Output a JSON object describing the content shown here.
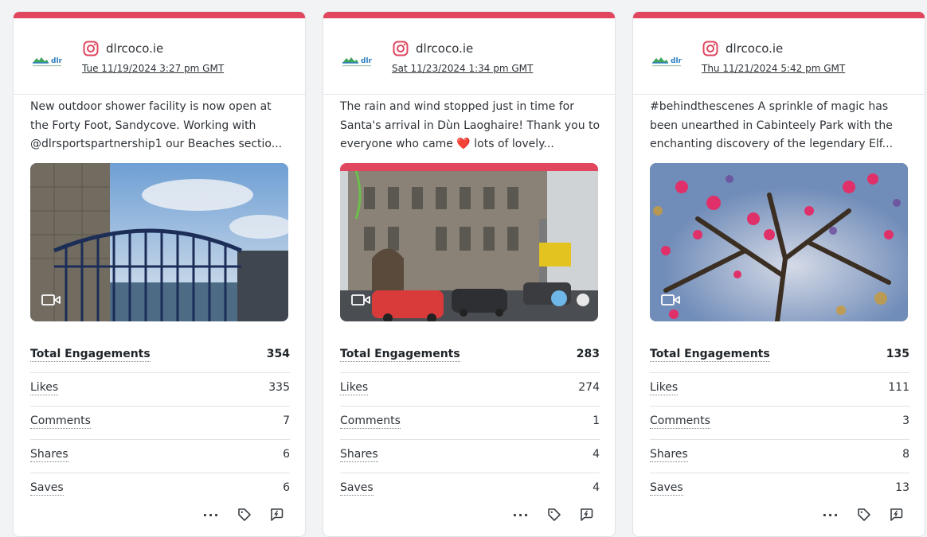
{
  "accent_color": "#e0475f",
  "posts": [
    {
      "network_icon": "instagram-icon",
      "handle": "dlrcoco.ie",
      "timestamp": "Tue 11/19/2024 3:27 pm GMT",
      "caption": "New outdoor shower facility is now open at the Forty Foot, Sandycove. Working with @dlrsportspartnership1 our Beaches sectio...",
      "media_type_icon": "video-icon",
      "metrics": [
        {
          "label": "Total Engagements",
          "value": "354"
        },
        {
          "label": "Likes",
          "value": "335"
        },
        {
          "label": "Comments",
          "value": "7"
        },
        {
          "label": "Shares",
          "value": "6"
        },
        {
          "label": "Saves",
          "value": "6"
        }
      ]
    },
    {
      "network_icon": "instagram-icon",
      "handle": "dlrcoco.ie",
      "timestamp": "Sat 11/23/2024 1:34 pm GMT",
      "caption": "The rain and wind stopped just in time for Santa's arrival in Dùn Laoghaire! Thank you to everyone who came ❤️ lots of lovely...",
      "media_type_icon": "video-icon",
      "metrics": [
        {
          "label": "Total Engagements",
          "value": "283"
        },
        {
          "label": "Likes",
          "value": "274"
        },
        {
          "label": "Comments",
          "value": "1"
        },
        {
          "label": "Shares",
          "value": "4"
        },
        {
          "label": "Saves",
          "value": "4"
        }
      ]
    },
    {
      "network_icon": "instagram-icon",
      "handle": "dlrcoco.ie",
      "timestamp": "Thu 11/21/2024 5:42 pm GMT",
      "caption": "#behindthescenes A sprinkle of magic has been unearthed in Cabinteely Park with the enchanting discovery of the legendary Elf...",
      "media_type_icon": "video-icon",
      "metrics": [
        {
          "label": "Total Engagements",
          "value": "135"
        },
        {
          "label": "Likes",
          "value": "111"
        },
        {
          "label": "Comments",
          "value": "3"
        },
        {
          "label": "Shares",
          "value": "8"
        },
        {
          "label": "Saves",
          "value": "13"
        }
      ]
    }
  ],
  "actions": {
    "more_label": "···",
    "more_icon": "more-icon",
    "tag_icon": "tag-icon",
    "reply_icon": "reply-icon"
  }
}
